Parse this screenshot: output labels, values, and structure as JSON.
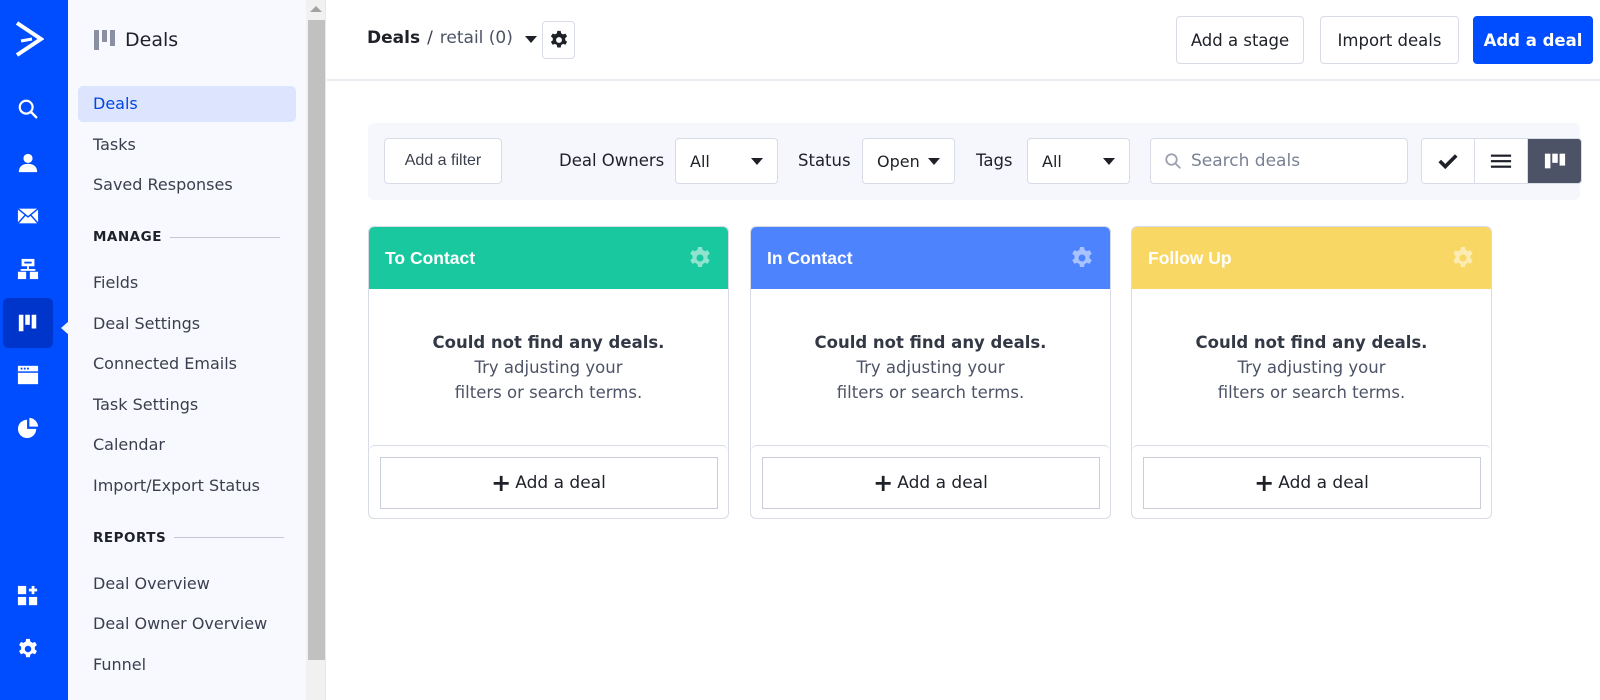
{
  "rail": {
    "items": [
      {
        "name": "search",
        "icon": "search-icon"
      },
      {
        "name": "contacts",
        "icon": "person-icon"
      },
      {
        "name": "campaigns",
        "icon": "envelope-icon"
      },
      {
        "name": "automations",
        "icon": "sitemap-icon"
      },
      {
        "name": "deals",
        "icon": "kanban-icon",
        "active": true
      },
      {
        "name": "website",
        "icon": "browser-window-icon"
      },
      {
        "name": "reports",
        "icon": "pie-chart-icon"
      },
      {
        "name": "apps",
        "icon": "apps-add-icon"
      },
      {
        "name": "settings",
        "icon": "gear-icon"
      }
    ],
    "bg_color": "#004cff"
  },
  "sidebar": {
    "title": "Deals",
    "items": [
      {
        "label": "Deals",
        "active": true
      },
      {
        "label": "Tasks"
      },
      {
        "label": "Saved Responses"
      }
    ],
    "manage": {
      "heading": "MANAGE",
      "items": [
        {
          "label": "Fields"
        },
        {
          "label": "Deal Settings"
        },
        {
          "label": "Connected Emails"
        },
        {
          "label": "Task Settings"
        },
        {
          "label": "Calendar"
        },
        {
          "label": "Import/Export Status"
        }
      ]
    },
    "reports": {
      "heading": "REPORTS",
      "items": [
        {
          "label": "Deal Overview"
        },
        {
          "label": "Deal Owner Overview"
        },
        {
          "label": "Funnel"
        }
      ]
    }
  },
  "header": {
    "breadcrumb_root": "Deals",
    "breadcrumb_sep": "/",
    "pipeline": "retail (0)",
    "buttons": {
      "add_stage": "Add a stage",
      "import_deals": "Import deals",
      "add_deal": "Add a deal"
    },
    "accent": "#004cff"
  },
  "filters": {
    "add_filter": "Add a filter",
    "deal_owners_label": "Deal Owners",
    "deal_owners_value": "All",
    "status_label": "Status",
    "status_value": "Open",
    "tags_label": "Tags",
    "tags_value": "All",
    "search_placeholder": "Search deals",
    "view_modes": [
      {
        "name": "tasks-view",
        "icon": "check-icon"
      },
      {
        "name": "list-view",
        "icon": "list-icon"
      },
      {
        "name": "kanban-view",
        "icon": "kanban-icon",
        "active": true
      }
    ]
  },
  "stages": [
    {
      "title": "To Contact",
      "color": "#1ac8a0",
      "gear_color": "#8fe4cf",
      "empty_title": "Could not find any deals.",
      "empty_line1": "Try adjusting your",
      "empty_line2": "filters or search terms.",
      "add_label": "Add a deal"
    },
    {
      "title": "In Contact",
      "color": "#4d84fe",
      "gear_color": "#a9c3ff",
      "empty_title": "Could not find any deals.",
      "empty_line1": "Try adjusting your",
      "empty_line2": "filters or search terms.",
      "add_label": "Add a deal"
    },
    {
      "title": "Follow Up",
      "color": "#f9d764",
      "gear_color": "#fcebb2",
      "empty_title": "Could not find any deals.",
      "empty_line1": "Try adjusting your",
      "empty_line2": "filters or search terms.",
      "add_label": "Add a deal"
    }
  ]
}
